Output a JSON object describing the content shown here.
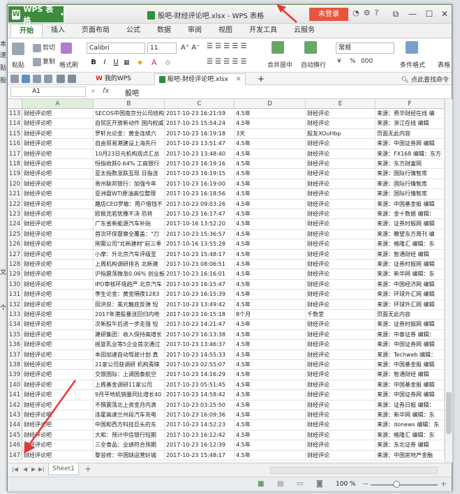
{
  "window": {
    "app_name": "WPS 表格",
    "title": "股吧-财经评论吧.xlsx - WPS 表格",
    "login": "未登录"
  },
  "ribbon_tabs": [
    "开始",
    "插入",
    "页面布局",
    "公式",
    "数据",
    "审阅",
    "视图",
    "开发工具",
    "云服务"
  ],
  "ribbon": {
    "paste": "粘贴",
    "cut": "剪切",
    "copy": "复制",
    "format_painter": "格式刷",
    "font_name": "Calibri",
    "font_size": "11",
    "bold": "B",
    "italic": "I",
    "underline": "U",
    "merge_center": "合并居中",
    "wrap_text": "自动换行",
    "number_format": "常规",
    "percent": "%",
    "comma": "000",
    "conditional_format": "条件格式",
    "table_style": "表格"
  },
  "doc_tabs": {
    "my_wps": "我的WPS",
    "file": "股吧-财经评论吧.xlsx",
    "search_cmd": "点此查找命令"
  },
  "formula_bar": {
    "cell_ref": "A1",
    "fx": "fx",
    "value": "股吧"
  },
  "columns": [
    "A",
    "B",
    "C",
    "D",
    "E",
    "F"
  ],
  "left_strip": [
    "本",
    "速",
    "贴",
    "股",
    "文",
    "个"
  ],
  "rows": [
    {
      "n": "113",
      "a": "财经评论吧",
      "b": "SECOS中国南京分公司结构",
      "c": "2017-10-23 16:21:59",
      "d": "4.5年",
      "e": "财经评论",
      "f": "来源：费华财经在线 编"
    },
    {
      "n": "114",
      "a": "财经评论吧",
      "b": "自贸区开放新动作 国内权威",
      "c": "2017-10-23 15:54:24",
      "d": "4.5年",
      "e": "财经评论",
      "f": "来源：浙江在线 编辑"
    },
    {
      "n": "115",
      "a": "财经评论吧",
      "b": "罗轩允论金：黄金连续六",
      "c": "2017-10-23 16:19:18",
      "d": "3天",
      "e": "股友XOuHbp",
      "f": "页面无此内容"
    },
    {
      "n": "116",
      "a": "财经评论吧",
      "b": "自由贸易港建设上海先行",
      "c": "2017-10-23 13:51:47",
      "d": "4.5年",
      "e": "财经评论",
      "f": "来源：中国证券网 编辑"
    },
    {
      "n": "117",
      "a": "财经评论吧",
      "b": "10月23日元机构观点汇总",
      "c": "2017-10-23 13:48:40",
      "d": "4.5年",
      "e": "财经评论",
      "f": "来源：FX168 编辑：东方"
    },
    {
      "n": "118",
      "a": "财经评论吧",
      "b": "恒指收跌0.64% 工商银行",
      "c": "2017-10-23 16:19:16",
      "d": "4.5年",
      "e": "财经评论",
      "f": "来源：东方财富网"
    },
    {
      "n": "119",
      "a": "财经评论吧",
      "b": "亚太指数涨跌互现 日指涨",
      "c": "2017-10-23 16:19:15",
      "d": "4.5年",
      "e": "财经评论",
      "f": "来源：国际行情智库"
    },
    {
      "n": "120",
      "a": "财经评论吧",
      "b": "贵州联邦银行：加强今年",
      "c": "2017-10-23 16:19:00",
      "d": "4.5年",
      "e": "财经评论",
      "f": "来源：国际行情智库"
    },
    {
      "n": "121",
      "a": "财经评论吧",
      "b": "亚洲盘WTI原油高位整理",
      "c": "2017-10-23 16:18:56",
      "d": "4.5年",
      "e": "财经评论",
      "f": "来源：国际行情智库"
    },
    {
      "n": "122",
      "a": "财经评论吧",
      "b": "趣店CEO罗敏：用户借钱不",
      "c": "2017-10-23 09:03:26",
      "d": "4.5年",
      "e": "财经评论",
      "f": "来源：中国基金报 编辑"
    },
    {
      "n": "123",
      "a": "财经评论吧",
      "b": "欧佩克若犹豫不决 恐将",
      "c": "2017-10-23 16:17:47",
      "d": "4.5年",
      "e": "财经评论",
      "f": "来源：金十数据 编辑："
    },
    {
      "n": "124",
      "a": "财经评论吧",
      "b": "广东省新能源汽车补贴",
      "c": "2017-10-16 13:52:20",
      "d": "4.5年",
      "e": "财经评论",
      "f": "来源：证券时报网 编辑"
    },
    {
      "n": "125",
      "a": "财经评论吧",
      "b": "首次环保督察全覆盖：\"刀",
      "c": "2017-10-23 15:36:57",
      "d": "4.5年",
      "e": "财经评论",
      "f": "来源：瞭望东方周刊 编"
    },
    {
      "n": "126",
      "a": "财经评论吧",
      "b": "刚需公司\"北新建材\"前三季",
      "c": "2017-10-16 13:55:28",
      "d": "4.5年",
      "e": "财经评论",
      "f": "来源：格隆汇 编辑：东"
    },
    {
      "n": "127",
      "a": "财经评论吧",
      "b": "小摩：升北京汽车评级至",
      "c": "2017-10-23 15:48:17",
      "d": "4.5年",
      "e": "财经评论",
      "f": "来源：智通财经 编辑"
    },
    {
      "n": "128",
      "a": "财经评论吧",
      "b": "上周机构调研排名 北新建",
      "c": "2017-10-23 08:06:51",
      "d": "4.5年",
      "e": "财经评论",
      "f": "来源：证券时报网 编辑"
    },
    {
      "n": "129",
      "a": "财经评论吧",
      "b": "沪指震荡微涨0.06% 创业板",
      "c": "2017-10-23 16:16:01",
      "d": "4.5年",
      "e": "财经评论",
      "f": "来源：新华网 编辑：东"
    },
    {
      "n": "130",
      "a": "财经评论吧",
      "b": "IPO审核环境趋严 北京汽车",
      "c": "2017-10-23 16:15:47",
      "d": "4.5年",
      "e": "财经评论",
      "f": "来源：中国经济网 编辑"
    },
    {
      "n": "131",
      "a": "财经评论吧",
      "b": "李生论金：黄金隔夜1283",
      "c": "2017-10-23 16:15:39",
      "d": "4.5年",
      "e": "财经评论",
      "f": "来源：环球外汇网 编辑"
    },
    {
      "n": "132",
      "a": "财经评论吧",
      "b": "田洪良：美元触底反弹 短",
      "c": "2017-10-23 13:49:42",
      "d": "4.5年",
      "e": "财经评论",
      "f": "来源：环球外汇网 编辑"
    },
    {
      "n": "133",
      "a": "财经评论吧",
      "b": "2017年港股暴涨回归内地",
      "c": "2017-10-23 16:15:18",
      "d": "8个月",
      "e": "千数堂",
      "f": "页面无此内容"
    },
    {
      "n": "134",
      "a": "财经评论吧",
      "b": "次新股午后进一步走强 短",
      "c": "2017-10-23 14:21:47",
      "d": "4.5年",
      "e": "财经评论",
      "f": "来源：证券时报网 编辑"
    },
    {
      "n": "135",
      "a": "财经评论吧",
      "b": "建研集团：收入保持高增长",
      "c": "2017-10-23 16:13:38",
      "d": "4.5年",
      "e": "财经评论",
      "f": "来源：中泰证券 编辑："
    },
    {
      "n": "136",
      "a": "财经评论吧",
      "b": "摇篮乳业等5企业首次通过",
      "c": "2017-10-23 13:46:37",
      "d": "4.5年",
      "e": "财经评论",
      "f": "来源：中国证券网 编辑"
    },
    {
      "n": "137",
      "a": "财经评论吧",
      "b": "本田加速自动驾驶计划 真",
      "c": "2017-10-23 14:55:33",
      "d": "4.5年",
      "e": "财经评论",
      "f": "来源：Techweb 编辑："
    },
    {
      "n": "138",
      "a": "财经评论吧",
      "b": "21家公司获调研 机构青睐",
      "c": "2017-10-23 02:55:07",
      "d": "4.5年",
      "e": "财经评论",
      "f": "来源：中国基金报 编辑"
    },
    {
      "n": "139",
      "a": "财经评论吧",
      "b": "交银国际：上调国泰航空",
      "c": "2017-10-23 14:16:29",
      "d": "4.5年",
      "e": "财经评论",
      "f": "来源：智通财经 编辑"
    },
    {
      "n": "140",
      "a": "财经评论吧",
      "b": "上周基金调研11家公司",
      "c": "2017-10-23 05:51:45",
      "d": "4.5年",
      "e": "财经评论",
      "f": "来源：中国基金报 编辑"
    },
    {
      "n": "141",
      "a": "财经评论吧",
      "b": "9月平地机销量同比增长40",
      "c": "2017-10-23 14:58:42",
      "d": "4.5年",
      "e": "财经评论",
      "f": "来源：中国证券网 编辑"
    },
    {
      "n": "142",
      "a": "财经评论吧",
      "b": "不惧震荡北上资金月内滴",
      "c": "2017-10-23 03:25:50",
      "d": "4.5年",
      "e": "财经评论",
      "f": "来源：证券日报 编辑："
    },
    {
      "n": "143",
      "a": "财经评论吧",
      "b": "连霍高速兰州段汽车充电",
      "c": "2017-10-23 16:09:36",
      "d": "4.5年",
      "e": "财经评论",
      "f": "来源：新华网 编辑：东"
    },
    {
      "n": "144",
      "a": "财经评论吧",
      "b": "中国和西方科技巨头的东",
      "c": "2017-10-23 14:52:23",
      "d": "4.5年",
      "e": "财经评论",
      "f": "来源：donews 编辑：东"
    },
    {
      "n": "145",
      "a": "财经评论吧",
      "b": "大和：预计中信银行短期",
      "c": "2017-10-23 16:12:42",
      "d": "4.5年",
      "e": "财经评论",
      "f": "来源：格隆汇 编辑：东"
    },
    {
      "n": "146",
      "a": "财经评论吧",
      "b": "三全食品：业绩符合预期",
      "c": "2017-10-23 16:12:39",
      "d": "4.5年",
      "e": "财经评论",
      "f": "来源：东北证券 编辑"
    },
    {
      "n": "147",
      "a": "财经评论吧",
      "b": "黎芸修：中国缺运营好城",
      "c": "2017-10-23 15:48:17",
      "d": "4.5年",
      "e": "财经评论",
      "f": "来源：中国房地产金融"
    }
  ],
  "sheet_bar": {
    "sheet": "Sheet1",
    "add": "+"
  },
  "status_bar": {
    "zoom": "100 %"
  },
  "colors": {
    "accent_green": "#3d8b3d",
    "login_red": "#e8553e",
    "arrow_red": "#e53935"
  }
}
